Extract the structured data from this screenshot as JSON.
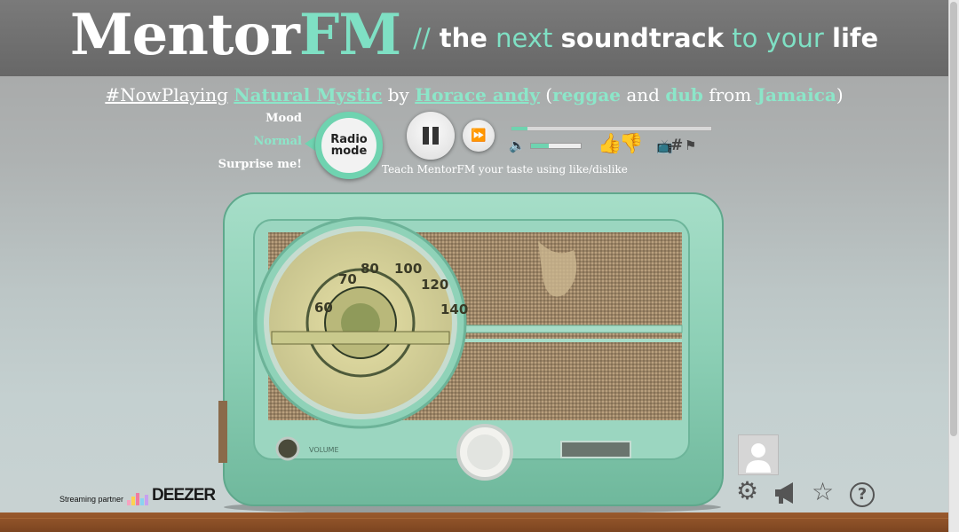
{
  "header": {
    "logo_main": "Mentor",
    "logo_accent": "FM",
    "tagline_slash": "//",
    "tagline_the": "the",
    "tagline_next": "next",
    "tagline_soundtrack": "soundtrack",
    "tagline_to_your": "to your",
    "tagline_life": "life"
  },
  "now_playing": {
    "tag": "#NowPlaying",
    "track": "Natural Mystic",
    "by": "by",
    "artist": "Horace andy",
    "paren_open": "(",
    "genre1": "reggae",
    "and": "and",
    "genre2": "dub",
    "from": "from",
    "country": "Jamaica",
    "paren_close": ")"
  },
  "mood": {
    "title": "Mood",
    "options": [
      "Normal",
      "Surprise me!"
    ],
    "selected": "Normal"
  },
  "radio_mode": {
    "line1": "Radio",
    "line2": "mode"
  },
  "player": {
    "teach_text": "Teach MentorFM your taste using like/dislike",
    "progress": 0.08,
    "volume": 0.35
  },
  "dial": {
    "numbers": [
      "60",
      "70",
      "80",
      "100",
      "120",
      "140"
    ],
    "volume_label": "VOLUME"
  },
  "partner": {
    "label": "Streaming partner",
    "brand": "DEEZER"
  },
  "colors": {
    "accent": "#7fe0c4",
    "radio_green": "#8dd3b5",
    "wood": "#8a4f26"
  },
  "icons": [
    "pause-icon",
    "next-icon",
    "volume-icon",
    "thumbs-up-icon",
    "thumbs-down-icon",
    "tv-icon",
    "hashtag-icon",
    "flag-icon",
    "gear-icon",
    "megaphone-icon",
    "star-icon",
    "help-icon"
  ]
}
